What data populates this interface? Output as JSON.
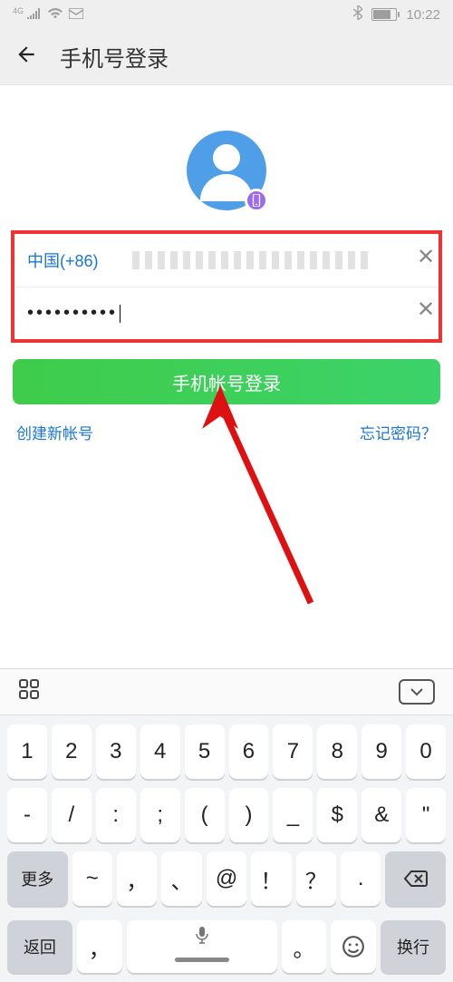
{
  "status": {
    "net_label": "4G",
    "time": "10:22"
  },
  "header": {
    "title": "手机号登录"
  },
  "form": {
    "country_code": "中国(+86)",
    "password_masked": "••••••••••"
  },
  "login_button": "手机帐号登录",
  "links": {
    "create": "创建新帐号",
    "forgot": "忘记密码？"
  },
  "keyboard": {
    "row1": [
      "1",
      "2",
      "3",
      "4",
      "5",
      "6",
      "7",
      "8",
      "9",
      "0"
    ],
    "row2": [
      "-",
      "/",
      ":",
      ";",
      "(",
      ")",
      "_",
      "$",
      "&",
      "\""
    ],
    "more": "更多",
    "row3": [
      "~",
      "，",
      "、",
      "@",
      "！",
      "？",
      "."
    ],
    "bottom": {
      "return": "返回",
      "newline": "换行"
    }
  }
}
